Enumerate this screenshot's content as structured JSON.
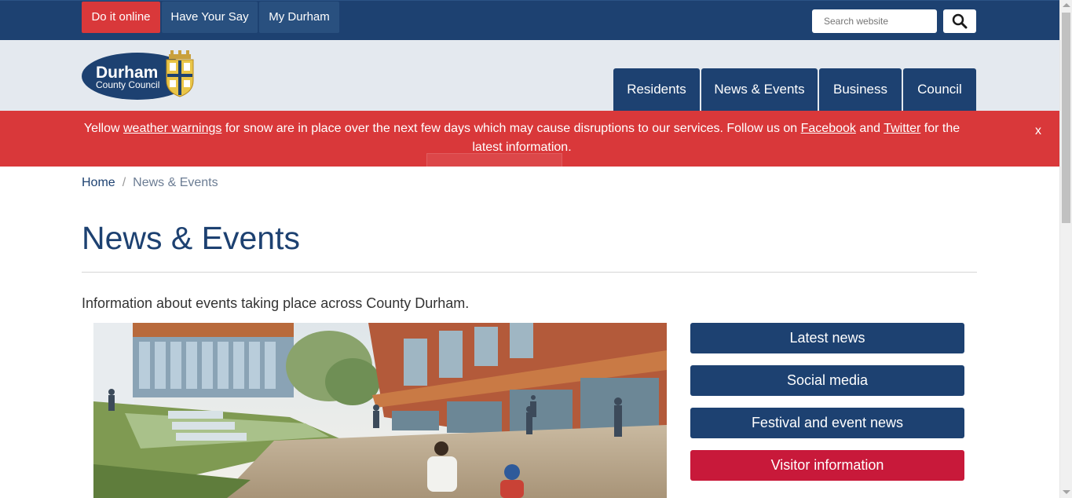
{
  "topbar": {
    "links": [
      "Do it online",
      "Have Your Say",
      "My Durham"
    ],
    "search_placeholder": "Search website"
  },
  "logo": {
    "line1": "Durham",
    "line2": "County Council"
  },
  "nav": [
    "Residents",
    "News & Events",
    "Business",
    "Council"
  ],
  "alert": {
    "text_1": "Yellow ",
    "link_1": "weather warnings",
    "text_2": " for snow are in place over the next few days which may cause disruptions to our services. Follow us on ",
    "link_2": "Facebook",
    "text_3": " and ",
    "link_3": "Twitter",
    "text_4": " for the latest information.",
    "close": "x"
  },
  "breadcrumb": {
    "home": "Home",
    "separator": "/",
    "current": "News & Events"
  },
  "page": {
    "title": "News & Events",
    "intro": "Information about events taking place across County Durham."
  },
  "side_buttons": [
    "Latest news",
    "Social media",
    "Festival and event news",
    "Visitor information"
  ],
  "colors": {
    "primary": "#1d4171",
    "alert": "#d9383a",
    "visitor": "#c8193a",
    "header_bg": "#e4e9ef"
  }
}
